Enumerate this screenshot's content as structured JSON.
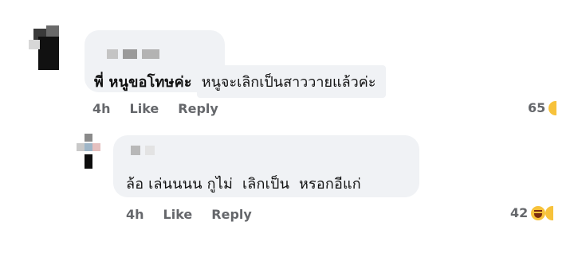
{
  "comments": [
    {
      "text_highlight": "พี่ หนูขอโทษค่ะ",
      "text_rest": "หนูจะเลิกเป็นสาววายแล้วค่ะ",
      "time": "4h",
      "like_label": "Like",
      "reply_label": "Reply",
      "reaction_count": "65"
    },
    {
      "text": "ล้อ เล่นนนน กูไม่  เลิกเป็น  หรอกอีแก่",
      "time": "4h",
      "like_label": "Like",
      "reply_label": "Reply",
      "reaction_count": "42"
    }
  ],
  "icons": {
    "reaction_1": "emoji-partial-icon",
    "reaction_2": "laughing-emoji-icon"
  },
  "colors": {
    "bubble": "#f0f2f5",
    "meta_text": "#65676b",
    "emoji": "#f7c23b"
  }
}
